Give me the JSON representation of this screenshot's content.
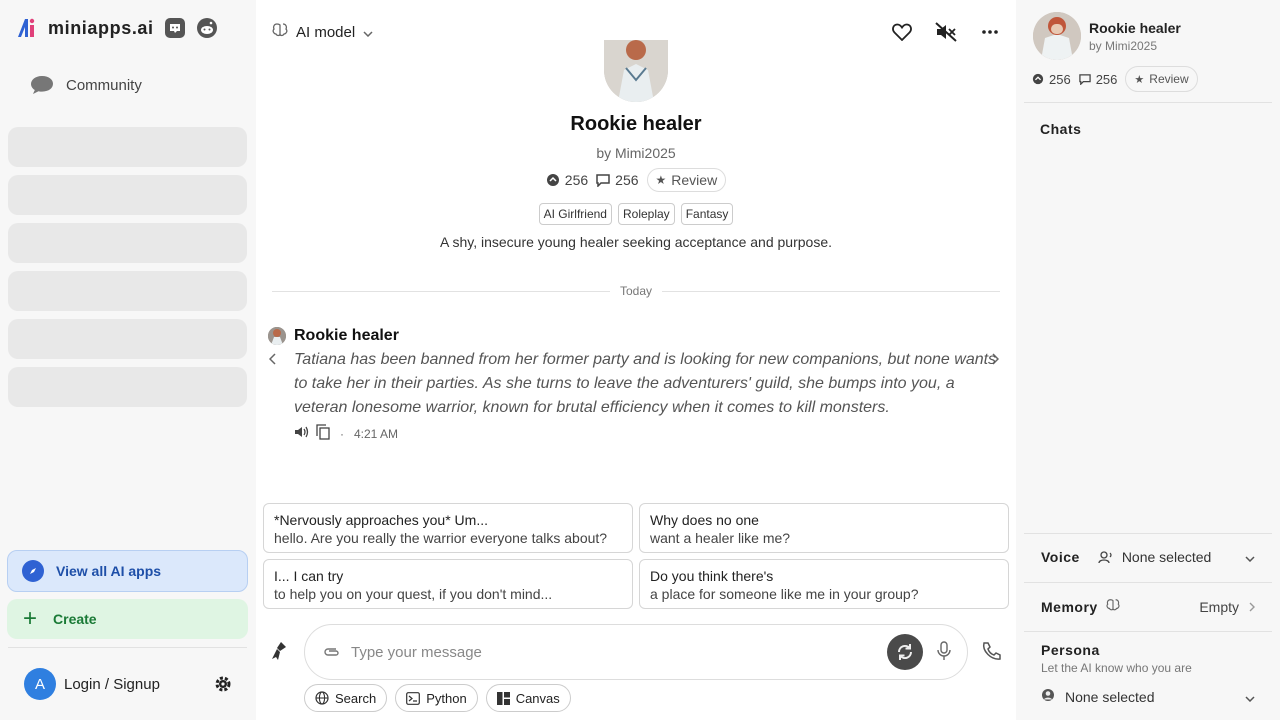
{
  "brand": {
    "name": "miniapps.ai"
  },
  "sidebar": {
    "community_label": "Community",
    "view_all_label": "View all AI apps",
    "create_label": "Create",
    "login_label": "Login / Signup",
    "avatar_initial": "A"
  },
  "header": {
    "model_label": "AI model"
  },
  "character": {
    "name": "Rookie healer",
    "by": "by Mimi2025",
    "chats_count": "256",
    "messages_count": "256",
    "review_label": "Review",
    "tags": [
      "AI Girlfriend",
      "Roleplay",
      "Fantasy"
    ],
    "description": "A shy, insecure young healer seeking acceptance and purpose."
  },
  "chat": {
    "date_divider": "Today",
    "message": {
      "author": "Rookie healer",
      "text": "Tatiana has been banned from her former party and is looking for new companions, but none wants to take her in their parties. As she turns to leave the adventurers' guild, she bumps into you, a veteran lonesome warrior, known for brutal efficiency when it comes to kill monsters.",
      "time": "4:21 AM"
    },
    "suggestions": [
      {
        "line1": "*Nervously approaches you* Um...",
        "line2": "hello. Are you really the warrior everyone talks about?"
      },
      {
        "line1": "Why does no one",
        "line2": "want a healer like me?"
      },
      {
        "line1": "I... I can try",
        "line2": "to help you on your quest, if you don't mind..."
      },
      {
        "line1": "Do you think there's",
        "line2": "a place for someone like me in your group?"
      }
    ]
  },
  "composer": {
    "placeholder": "Type your message",
    "tools": [
      "Search",
      "Python",
      "Canvas"
    ]
  },
  "right_panel": {
    "title": "Rookie healer",
    "by": "by Mimi2025",
    "chats_count": "256",
    "messages_count": "256",
    "review_label": "Review",
    "chats_heading": "Chats",
    "voice_label": "Voice",
    "voice_value": "None selected",
    "memory_label": "Memory",
    "memory_value": "Empty",
    "persona_label": "Persona",
    "persona_sub": "Let the AI know who you are",
    "persona_value": "None selected"
  },
  "colors": {
    "accent_blue": "#2f62d3",
    "create_green": "#1a7a36",
    "sidebar_bg": "#f7f7f7"
  }
}
